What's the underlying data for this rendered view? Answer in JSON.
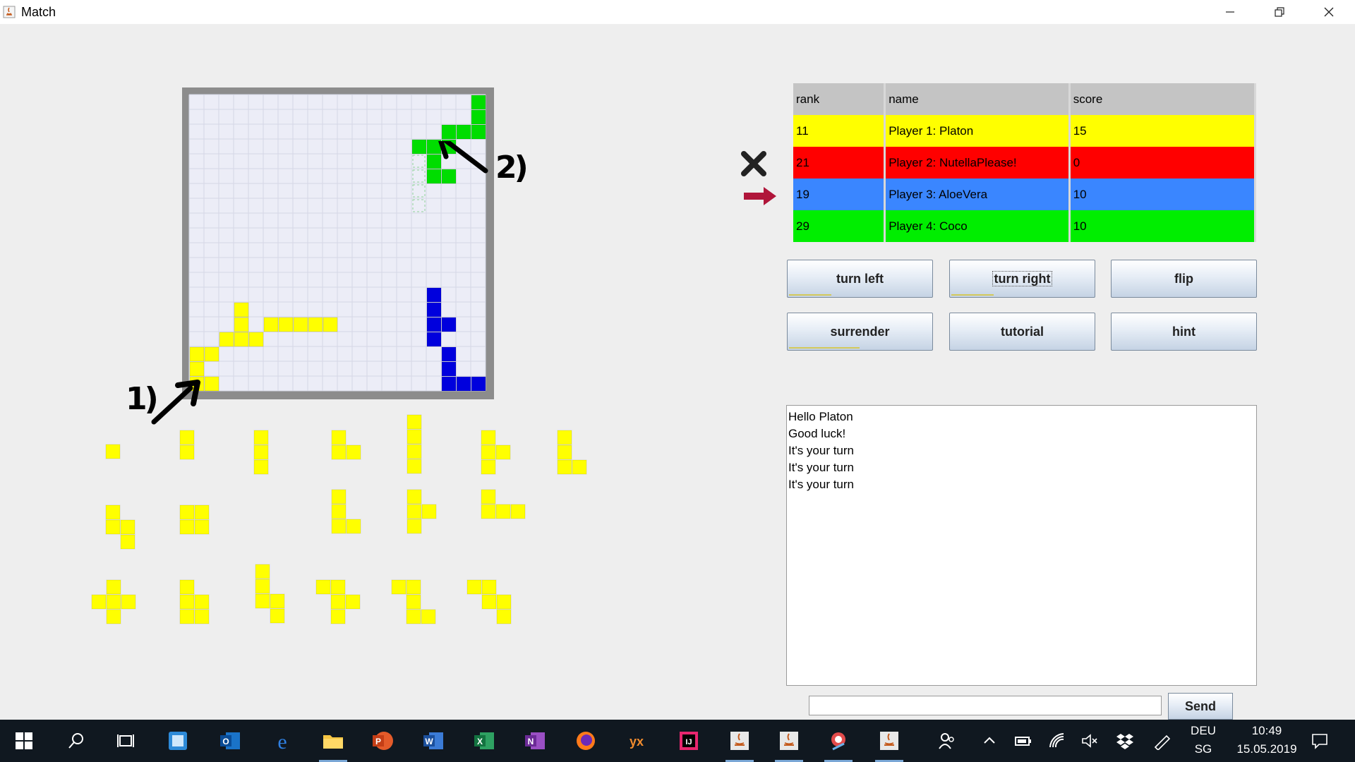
{
  "window": {
    "title": "Match"
  },
  "score_table": {
    "headers": {
      "rank": "rank",
      "name": "name",
      "score": "score"
    },
    "rows": [
      {
        "rank": "11",
        "name": "Player 1: Platon",
        "score": "15",
        "color": "#ffff00"
      },
      {
        "rank": "21",
        "name": "Player 2: NutellaPlease!",
        "score": "0",
        "color": "#ff0000"
      },
      {
        "rank": "19",
        "name": "Player 3: AloeVera",
        "score": "10",
        "color": "#3a86ff"
      },
      {
        "rank": "29",
        "name": "Player 4: Coco",
        "score": "10",
        "color": "#00ee00"
      }
    ]
  },
  "buttons": {
    "turn_left": "turn left",
    "turn_right": "turn right",
    "flip": "flip",
    "surrender": "surrender",
    "tutorial": "tutorial",
    "hint": "hint"
  },
  "chat": {
    "messages": [
      "Hello Platon",
      "Good luck!",
      "It's your turn",
      "It's your turn",
      "It's your turn"
    ],
    "input_value": "",
    "send_label": "Send"
  },
  "annotations": {
    "label_1": "1)",
    "label_2": "2)"
  },
  "taskbar": {
    "language": "DEU",
    "keyboard": "SG",
    "time": "10:49",
    "date": "15.05.2019"
  },
  "colors": {
    "yellow": "#ffff00",
    "green": "#00dd00",
    "blue": "#0000dd",
    "board_bg": "#ecedf7",
    "board_frame": "#8c8c8c"
  }
}
